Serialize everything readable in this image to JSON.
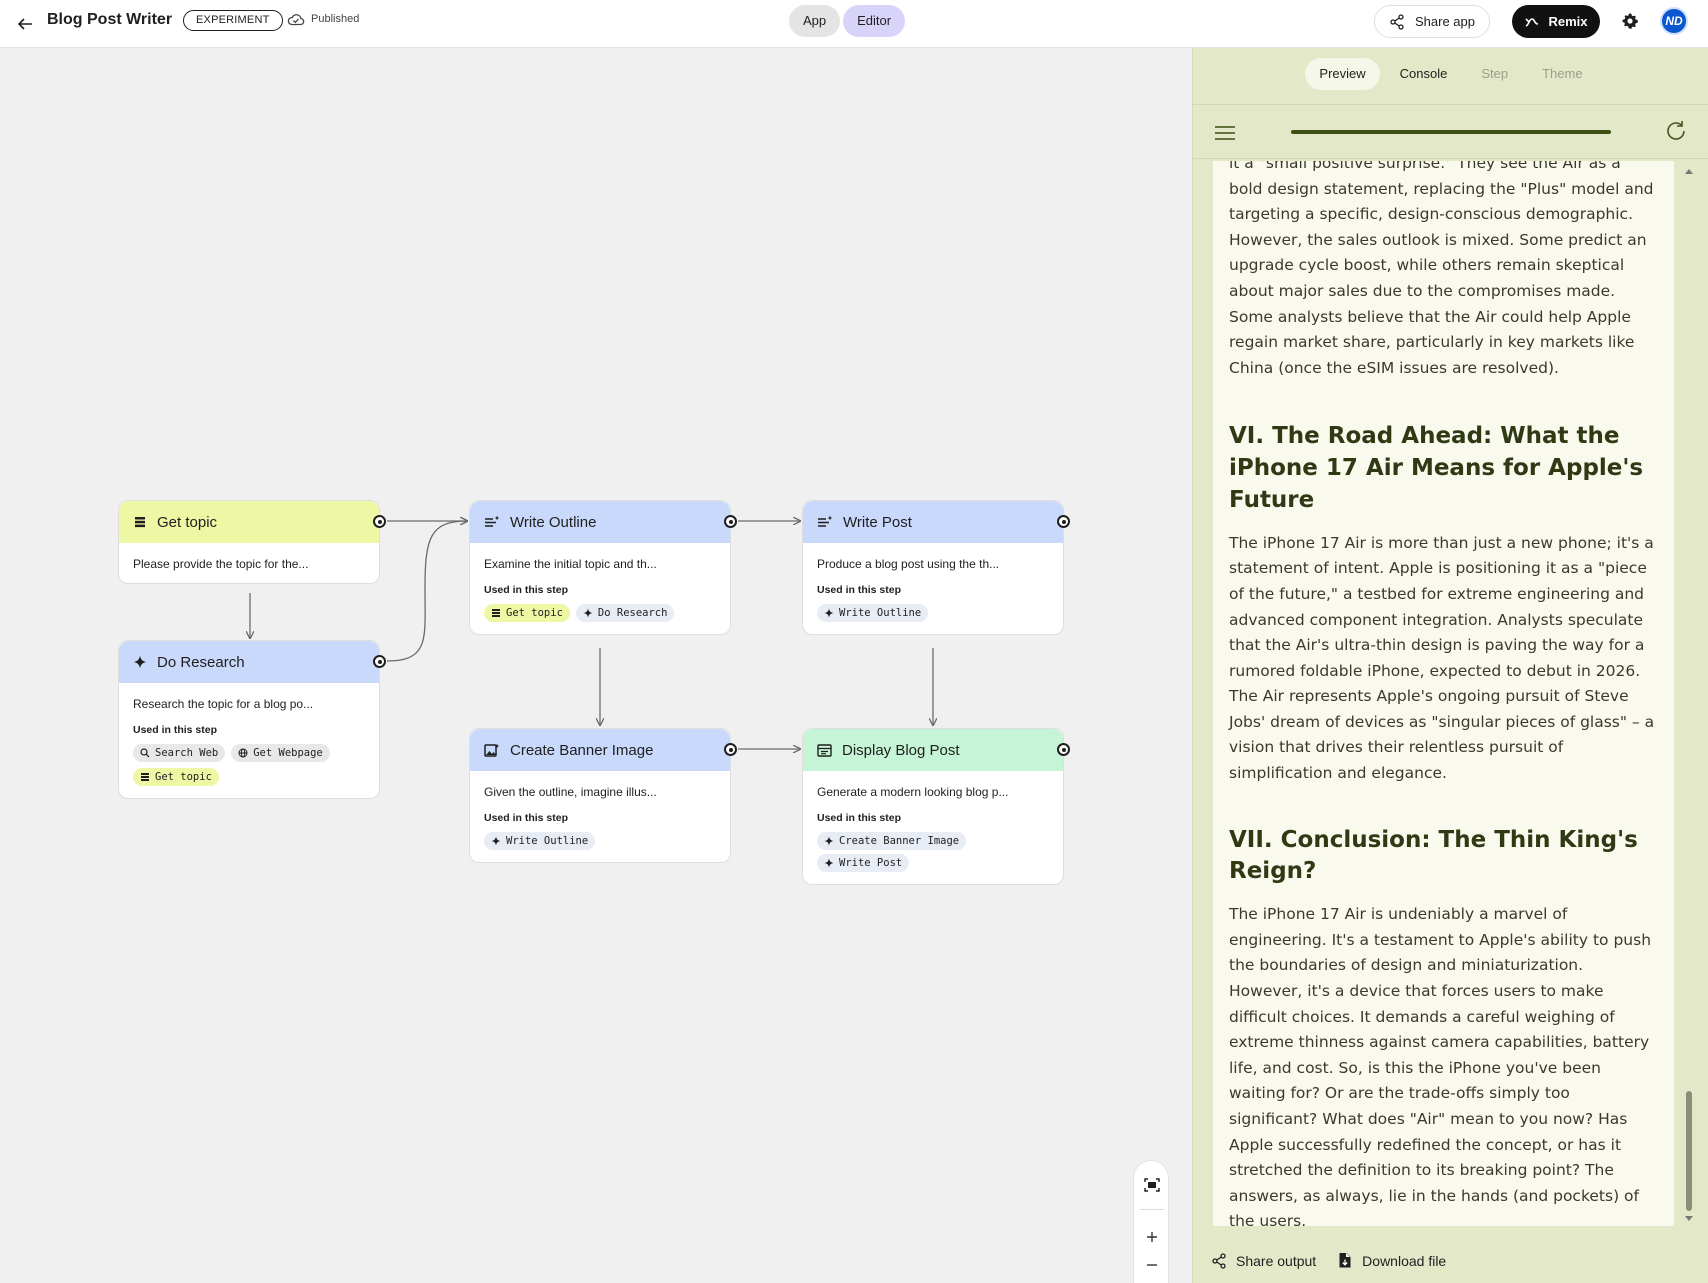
{
  "header": {
    "title": "Blog Post Writer",
    "badge": "EXPERIMENT",
    "status": "Published",
    "mode_app": "App",
    "mode_editor": "Editor",
    "share_app": "Share app",
    "remix": "Remix",
    "avatar_initials": "ND"
  },
  "nodes": {
    "get_topic": {
      "title": "Get topic",
      "desc": "Please provide the topic for the..."
    },
    "do_research": {
      "title": "Do Research",
      "desc": "Research the topic for a blog po...",
      "used_label": "Used in this step",
      "chips": [
        "Search Web",
        "Get Webpage",
        "Get topic"
      ]
    },
    "write_outline": {
      "title": "Write Outline",
      "desc": "Examine the initial topic and th...",
      "used_label": "Used in this step",
      "chips": [
        "Get topic",
        "Do Research"
      ]
    },
    "write_post": {
      "title": "Write Post",
      "desc": "Produce a blog post using the th...",
      "used_label": "Used in this step",
      "chips": [
        "Write Outline"
      ]
    },
    "create_banner": {
      "title": "Create Banner Image",
      "desc": "Given the outline, imagine illus...",
      "used_label": "Used in this step",
      "chips": [
        "Write Outline"
      ]
    },
    "display_post": {
      "title": "Display Blog Post",
      "desc": "Generate a modern looking blog p...",
      "used_label": "Used in this step",
      "chips": [
        "Create Banner Image",
        "Write Post"
      ]
    }
  },
  "panel": {
    "tabs": [
      "Preview",
      "Console",
      "Step",
      "Theme"
    ],
    "active_tab": "Preview",
    "progress_fraction": 1.0,
    "output": {
      "p1": "it a \"small positive surprise.\" They see the Air as a bold design statement, replacing the \"Plus\" model and targeting a specific, design-conscious demographic. However, the sales outlook is mixed. Some predict an upgrade cycle boost, while others remain skeptical about major sales due to the compromises made. Some analysts believe that the Air could help Apple regain market share, particularly in key markets like China (once the eSIM issues are resolved).",
      "h6": "VI. The Road Ahead: What the iPhone 17 Air Means for Apple's Future",
      "p6": "The iPhone 17 Air is more than just a new phone; it's a statement of intent. Apple is positioning it as a \"piece of the future,\" a testbed for extreme engineering and advanced component integration. Analysts speculate that the Air's ultra-thin design is paving the way for a rumored foldable iPhone, expected to debut in 2026. The Air represents Apple's ongoing pursuit of Steve Jobs' dream of devices as \"singular pieces of glass\" – a vision that drives their relentless pursuit of simplification and elegance.",
      "h7": "VII. Conclusion: The Thin King's Reign?",
      "p7": "The iPhone 17 Air is undeniably a marvel of engineering. It's a testament to Apple's ability to push the boundaries of design and miniaturization. However, it's a device that forces users to make difficult choices. It demands a careful weighing of extreme thinness against camera capabilities, battery life, and cost. So, is this the iPhone you've been waiting for? Or are the trade-offs simply too significant? What does \"Air\" mean to you now? Has Apple successfully redefined the concept, or has it stretched the definition to its breaking point? The answers, as always, lie in the hands (and pockets) of the users."
    },
    "share_output": "Share output",
    "download_file": "Download file"
  },
  "colors": {
    "accent_editor": "#d8d3f8",
    "node_yellow": "#eef8a4",
    "node_blue": "#c8d9fb",
    "node_green": "#c5f5d6",
    "panel_bg": "#e3e9c8",
    "avatar": "#0b57d0"
  }
}
